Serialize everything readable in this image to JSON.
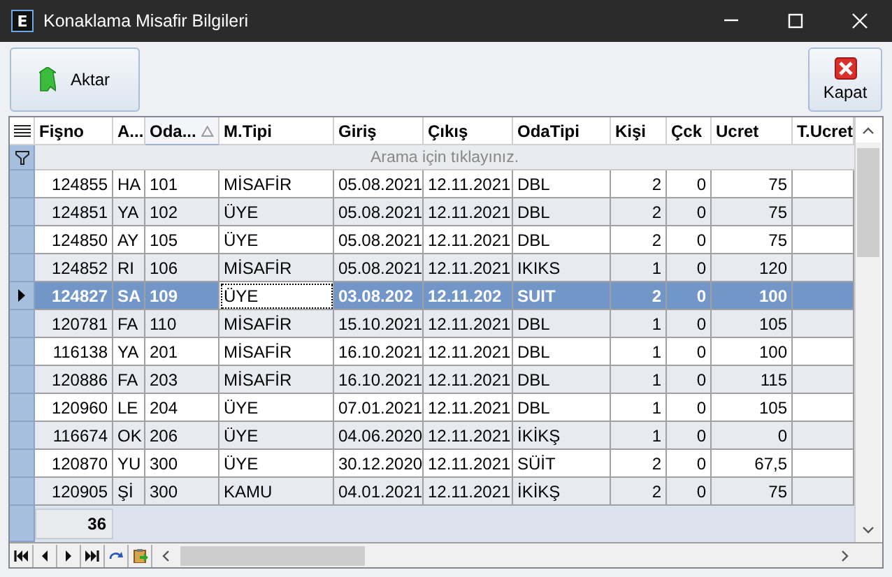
{
  "window": {
    "title": "Konaklama Misafir Bilgileri",
    "app_icon": "E"
  },
  "toolbar": {
    "buttons": [
      {
        "label": "Aktar",
        "kind": "export"
      },
      {
        "label": "Kapat",
        "kind": "close"
      }
    ]
  },
  "table": {
    "columns": [
      {
        "label": "Fişno",
        "kind": "number",
        "sorted": false,
        "focused": false
      },
      {
        "label": "A...",
        "kind": "text",
        "sorted": false,
        "focused": false
      },
      {
        "label": "Oda...",
        "kind": "text",
        "sorted": true,
        "focused": false
      },
      {
        "label": "M.Tipi",
        "kind": "text",
        "sorted": false,
        "focused": true
      },
      {
        "label": "Giriş",
        "kind": "text",
        "sorted": false,
        "focused": false
      },
      {
        "label": "Çıkış",
        "kind": "text",
        "sorted": false,
        "focused": false
      },
      {
        "label": "OdaTipi",
        "kind": "text",
        "sorted": false,
        "focused": false
      },
      {
        "label": "Kişi",
        "kind": "number",
        "sorted": false,
        "focused": false
      },
      {
        "label": "Çck",
        "kind": "number",
        "sorted": false,
        "focused": false
      },
      {
        "label": "Ucret",
        "kind": "number",
        "sorted": false,
        "focused": false
      },
      {
        "label": "T.Ucret",
        "kind": "number",
        "sorted": false,
        "focused": false
      }
    ],
    "filter": {
      "placeholder": "Arama için tıklayınız."
    },
    "rows": [
      {
        "selected": false,
        "cells": [
          "124855",
          "HA",
          "101",
          "MİSAFİR",
          "05.08.2021",
          "12.11.2021",
          "DBL",
          "2",
          "0",
          "75"
        ]
      },
      {
        "selected": false,
        "cells": [
          "124851",
          "YA",
          "102",
          "ÜYE",
          "05.08.2021",
          "12.11.2021",
          "DBL",
          "2",
          "0",
          "75"
        ]
      },
      {
        "selected": false,
        "cells": [
          "124850",
          "AY",
          "105",
          "ÜYE",
          "05.08.2021",
          "12.11.2021",
          "DBL",
          "2",
          "0",
          "75"
        ]
      },
      {
        "selected": false,
        "cells": [
          "124852",
          "RI",
          "106",
          "MİSAFİR",
          "05.08.2021",
          "12.11.2021",
          "IKIKS",
          "1",
          "0",
          "120"
        ]
      },
      {
        "selected": true,
        "cells": [
          "124827",
          "SA",
          "109",
          "ÜYE",
          "03.08.202",
          "12.11.202",
          "SUIT",
          "2",
          "0",
          "100"
        ]
      },
      {
        "selected": false,
        "cells": [
          "120781",
          "FA",
          "110",
          "MİSAFİR",
          "15.10.2021",
          "12.11.2021",
          "DBL",
          "1",
          "0",
          "105"
        ]
      },
      {
        "selected": false,
        "cells": [
          "116138",
          "YA",
          "201",
          "MİSAFİR",
          "16.10.2021",
          "12.11.2021",
          "DBL",
          "1",
          "0",
          "100"
        ]
      },
      {
        "selected": false,
        "cells": [
          "120886",
          "FA",
          "203",
          "MİSAFİR",
          "16.10.2021",
          "12.11.2021",
          "DBL",
          "1",
          "0",
          "115"
        ]
      },
      {
        "selected": false,
        "cells": [
          "120960",
          "LE",
          "204",
          "ÜYE",
          "07.01.2021",
          "12.11.2021",
          "DBL",
          "1",
          "0",
          "105"
        ]
      },
      {
        "selected": false,
        "cells": [
          "116674",
          "OK",
          "206",
          "ÜYE",
          "04.06.2020",
          "12.11.2021",
          "İKİKŞ",
          "1",
          "0",
          "0"
        ]
      },
      {
        "selected": false,
        "cells": [
          "120870",
          "YU",
          "300",
          "ÜYE",
          "30.12.2020",
          "12.11.2021",
          "SÜİT",
          "2",
          "0",
          "67,5"
        ]
      },
      {
        "selected": false,
        "cells": [
          "120905",
          "Şİ",
          "300",
          "KAMU",
          "04.01.2021",
          "12.11.2021",
          "İKİKŞ",
          "2",
          "0",
          "75"
        ]
      }
    ],
    "footer": {
      "count": "36"
    }
  }
}
